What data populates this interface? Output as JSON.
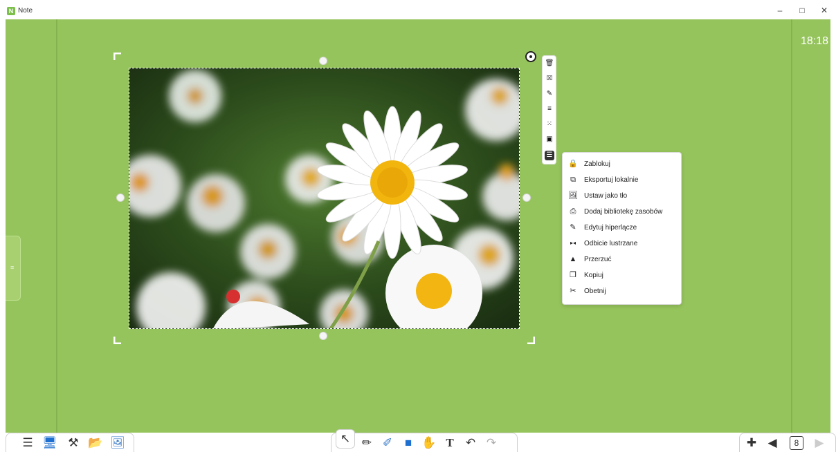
{
  "app": {
    "title": "Note",
    "icon_letter": "N"
  },
  "window_controls": {
    "minimize": "–",
    "restore": "□",
    "close": "✕"
  },
  "clock": "18:18",
  "photo": {
    "subject": "white daisies with yellow centers"
  },
  "image_toolbar": [
    {
      "name": "delete-icon",
      "glyph": "🗑"
    },
    {
      "name": "crop-icon",
      "glyph": "⮽"
    },
    {
      "name": "edit-image-icon",
      "glyph": "✎"
    },
    {
      "name": "align-icon",
      "glyph": "≡"
    },
    {
      "name": "effects-icon",
      "glyph": "⁙"
    },
    {
      "name": "layer-icon",
      "glyph": "▣"
    },
    {
      "name": "more-menu-icon",
      "glyph": "☰"
    }
  ],
  "context_menu": [
    {
      "label": "Zablokuj",
      "icon": "lock-icon",
      "glyph": "🔒"
    },
    {
      "label": "Eksportuj lokalnie",
      "icon": "export-icon",
      "glyph": "⧉"
    },
    {
      "label": "Ustaw jako tło",
      "icon": "set-background-icon",
      "glyph": "🖼"
    },
    {
      "label": "Dodaj bibliotekę zasobów",
      "icon": "add-library-icon",
      "glyph": "⎙"
    },
    {
      "label": "Edytuj hiperlącze",
      "icon": "hyperlink-icon",
      "glyph": "✎"
    },
    {
      "label": "Odbicie lustrzane",
      "icon": "mirror-icon",
      "glyph": "▸◂"
    },
    {
      "label": "Przerzuć",
      "icon": "flip-icon",
      "glyph": "▲"
    },
    {
      "label": "Kopiuj",
      "icon": "copy-icon",
      "glyph": "❐"
    },
    {
      "label": "Obetnij",
      "icon": "scissors-icon",
      "glyph": "✂"
    }
  ],
  "bottom_left": [
    {
      "name": "menu-icon",
      "glyph": "☰"
    },
    {
      "name": "screen-icon",
      "glyph": "🖥"
    },
    {
      "name": "tools-icon",
      "glyph": "⚒"
    },
    {
      "name": "folder-icon",
      "glyph": "📂"
    },
    {
      "name": "image-icon",
      "glyph": "🖼"
    }
  ],
  "bottom_center": [
    {
      "name": "select-cursor-icon",
      "glyph": "↖"
    },
    {
      "name": "pen-icon",
      "glyph": "✏"
    },
    {
      "name": "eraser-icon",
      "glyph": "✐"
    },
    {
      "name": "shape-icon",
      "glyph": "■"
    },
    {
      "name": "hand-icon",
      "glyph": "✋"
    },
    {
      "name": "text-icon",
      "glyph": "T"
    },
    {
      "name": "undo-icon",
      "glyph": "↶"
    },
    {
      "name": "redo-icon",
      "glyph": "↷"
    }
  ],
  "bottom_right": {
    "add": "✚",
    "prev": "◀",
    "page_number": "8",
    "next": "▶"
  },
  "left_tab_glyph": "≡",
  "colors": {
    "board": "#96c45c",
    "accent": "#7cbf4a"
  }
}
